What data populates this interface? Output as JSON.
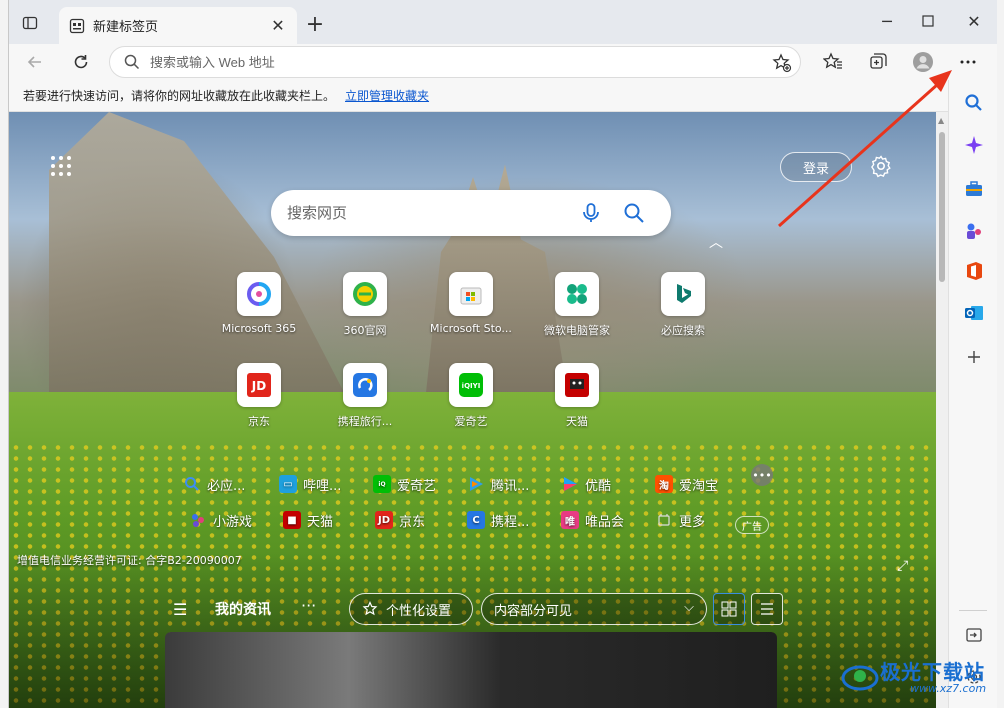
{
  "tab": {
    "title": "新建标签页"
  },
  "address": {
    "placeholder": "搜索或输入 Web 地址"
  },
  "favbar": {
    "hint": "若要进行快速访问，请将你的网址收藏放在此收藏夹栏上。",
    "link": "立即管理收藏夹"
  },
  "header": {
    "login": "登录"
  },
  "search": {
    "placeholder": "搜索网页"
  },
  "tiles": [
    {
      "label": "Microsoft 365",
      "icon": "microsoft-365-icon",
      "color": "#6b5cf0"
    },
    {
      "label": "360官网",
      "icon": "360-icon",
      "color": "#2fb24a"
    },
    {
      "label": "Microsoft Sto...",
      "icon": "microsoft-store-icon",
      "color": "#f25022"
    },
    {
      "label": "微软电脑管家",
      "icon": "pc-manager-icon",
      "color": "#13a37a"
    },
    {
      "label": "必应搜索",
      "icon": "bing-icon",
      "color": "#0e7a6e"
    },
    {
      "label": "京东",
      "icon": "jd-icon",
      "color": "#e1251b"
    },
    {
      "label": "携程旅行...",
      "icon": "ctrip-icon",
      "color": "#2577e3"
    },
    {
      "label": "爱奇艺",
      "icon": "iqiyi-icon",
      "color": "#00be06"
    },
    {
      "label": "天猫",
      "icon": "tmall-icon",
      "color": "#c40000"
    }
  ],
  "quicklinks": [
    {
      "label": "必应...",
      "icon": "search-icon",
      "color": "#2d6fd6"
    },
    {
      "label": "哔哩...",
      "icon": "bilibili-icon",
      "color": "#1fa0dd"
    },
    {
      "label": "爱奇艺",
      "icon": "iqiyi-icon",
      "color": "#00be06"
    },
    {
      "label": "腾讯...",
      "icon": "tencent-video-icon",
      "color": "#2f9fe8"
    },
    {
      "label": "优酷",
      "icon": "youku-icon",
      "color": "#1ea3f7"
    },
    {
      "label": "爱淘宝",
      "icon": "taobao-icon",
      "color": "#ff5000"
    },
    {
      "label": "小游戏",
      "icon": "game-icon",
      "color": "#6a4bd6"
    },
    {
      "label": "天猫",
      "icon": "tmall-icon",
      "color": "#c40000"
    },
    {
      "label": "京东",
      "icon": "jd-icon",
      "color": "#e1251b"
    },
    {
      "label": "携程...",
      "icon": "ctrip-icon",
      "color": "#2577e3"
    },
    {
      "label": "唯品会",
      "icon": "vip-icon",
      "color": "#e83b83"
    },
    {
      "label": "更多",
      "icon": "more-icon",
      "color": "#666666"
    }
  ],
  "ad_label": "广告",
  "license": "增值电信业务经营许可证: 合字B2-20090007",
  "feed": {
    "title": "我的资讯",
    "personalize": "个性化设置",
    "visibility": "内容部分可见"
  },
  "watermark": {
    "text": "极光下载站",
    "sub": "www.xz7.com"
  }
}
